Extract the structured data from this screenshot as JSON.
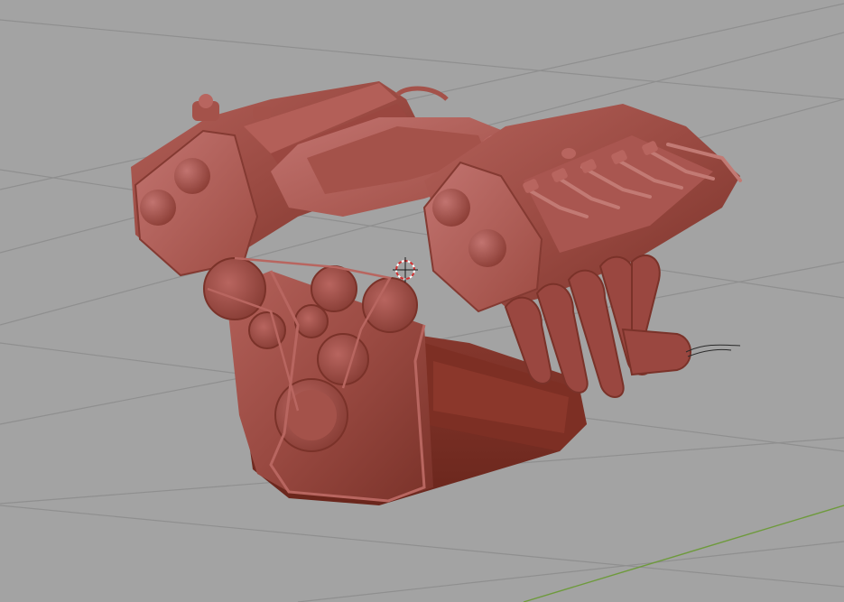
{
  "viewport": {
    "background_color": "#a3a3a3",
    "grid_line_color": "#8f8f8f",
    "x_axis_color": "#6e9a3c",
    "model_base_color": "#9e4c43",
    "model_shadow_color": "#6a2a22",
    "model_highlight_color": "#b86660",
    "cursor_icon": "3d-cursor-icon"
  }
}
